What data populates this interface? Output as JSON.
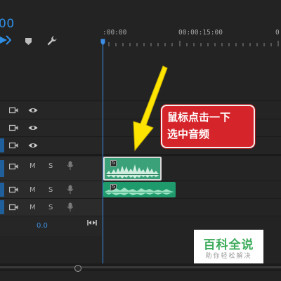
{
  "header": {
    "timecode": "00",
    "ruler": {
      "start_label": ":00:00",
      "mid_label": "00:00:15:00",
      "end_label": "0"
    }
  },
  "tracks": {
    "video": [
      {
        "id": "V3"
      },
      {
        "id": "V2"
      },
      {
        "id": "V1"
      }
    ],
    "audio": [
      {
        "id": "A1",
        "mute": "M",
        "solo": "S"
      },
      {
        "id": "A2",
        "mute": "M",
        "solo": "S"
      },
      {
        "id": "A3",
        "mute": "M",
        "solo": "S"
      }
    ],
    "master_volume": "0.0"
  },
  "clips": [
    {
      "track": "A1",
      "selected": true,
      "fx": "fx",
      "color": "#3aa178"
    },
    {
      "track": "A2",
      "selected": false,
      "fx": "fx",
      "color": "#1f9a6d"
    }
  ],
  "annotation": {
    "line1": "鼠标点击一下",
    "line2": "选中音频",
    "arrow_color": "#ffe400",
    "box_color": "#d5242a"
  },
  "watermark": {
    "title": "百科全说",
    "subtitle": "助你轻松解决"
  },
  "colors": {
    "accent": "#2f8fe6",
    "background": "#232323"
  },
  "icons": [
    "snap-icon",
    "marker-icon",
    "wrench-icon",
    "camera-icon",
    "eye-icon",
    "microphone-icon",
    "gap-icon"
  ]
}
